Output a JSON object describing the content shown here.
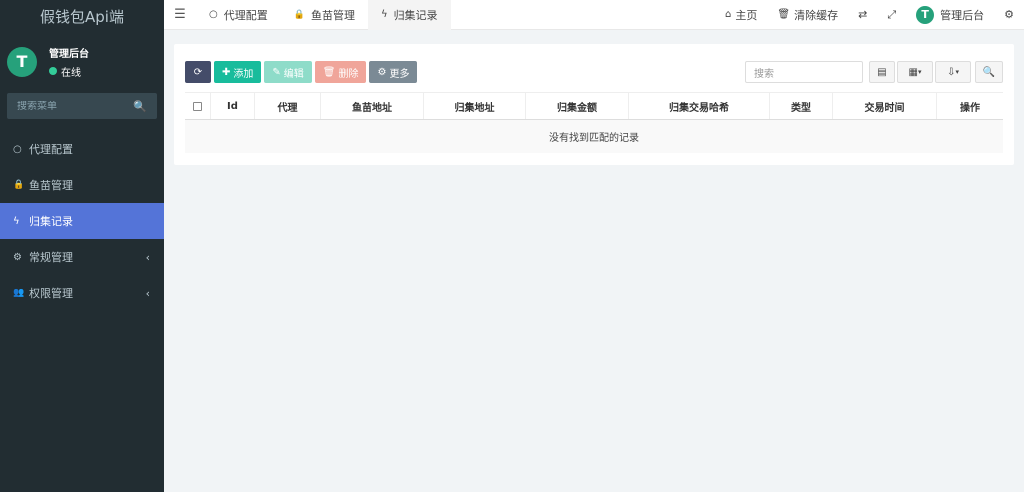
{
  "brand": {
    "title": "假钱包Api端"
  },
  "user": {
    "name": "管理后台",
    "status": "在线",
    "avatar_letter": "T"
  },
  "sidebar": {
    "search_placeholder": "搜索菜单",
    "items": [
      {
        "label": "代理配置",
        "icon": "circle-icon",
        "glyph": "○"
      },
      {
        "label": "鱼苗管理",
        "icon": "lock-icon",
        "glyph": "🔒"
      },
      {
        "label": "归集记录",
        "icon": "bolt-icon",
        "glyph": "ϟ",
        "active": true
      },
      {
        "label": "常规管理",
        "icon": "cogs-icon",
        "glyph": "⚙"
      },
      {
        "label": "权限管理",
        "icon": "users-icon",
        "glyph": "👥"
      }
    ]
  },
  "header": {
    "tabs": [
      {
        "label": "代理配置"
      },
      {
        "label": "鱼苗管理"
      },
      {
        "label": "归集记录"
      }
    ],
    "home_label": "主页",
    "clear_cache_label": "清除缓存",
    "admin_label": "管理后台"
  },
  "toolbar": {
    "add_label": "添加",
    "edit_label": "编辑",
    "delete_label": "删除",
    "more_label": "更多",
    "search_placeholder": "搜索"
  },
  "table": {
    "columns": [
      "Id",
      "代理",
      "鱼苗地址",
      "归集地址",
      "归集金额",
      "归集交易哈希",
      "类型",
      "交易时间",
      "操作"
    ],
    "empty_text": "没有找到匹配的记录"
  },
  "colors": {
    "accent": "#5474d8",
    "sidebar_bg": "#222d32",
    "success": "#18bc9c",
    "danger": "#f0a59a"
  }
}
